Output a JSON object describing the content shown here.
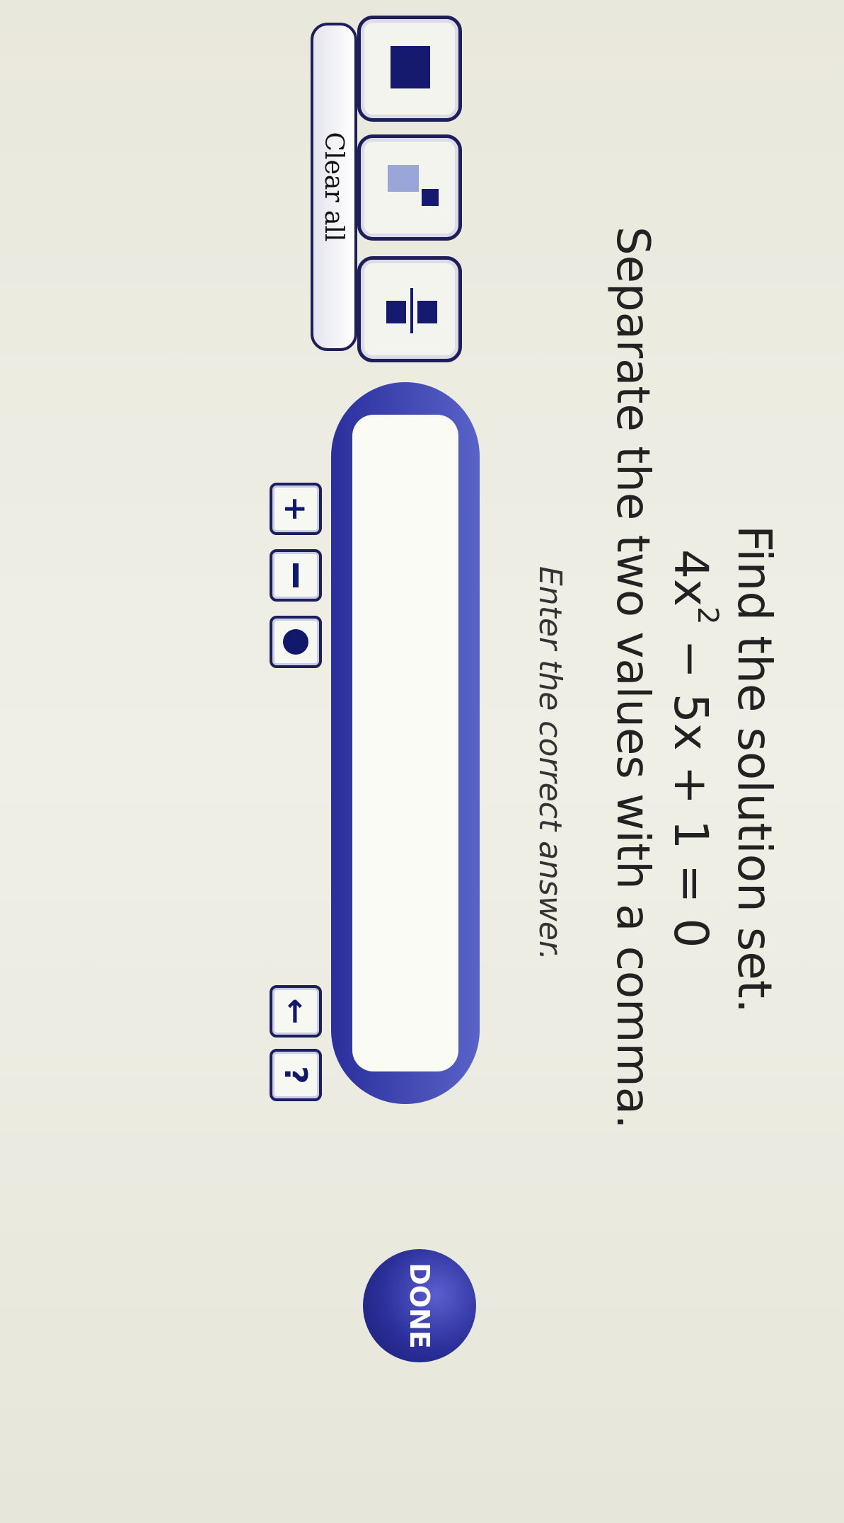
{
  "question": {
    "prompt": "Find the solution set.",
    "equation_prefix": "4x",
    "equation_exponent": "2",
    "equation_suffix": " − 5x + 1 = 0",
    "instruction": "Separate the two values with a comma.",
    "enter_hint": "Enter the correct answer."
  },
  "toolbar": {
    "template_icons": [
      "box-template-icon",
      "exponent-template-icon",
      "fraction-template-icon"
    ],
    "clear_label": "Clear all",
    "plus_symbol": "+",
    "help_symbol": "?",
    "backspace_symbol": "←"
  },
  "answer": {
    "value": ""
  },
  "done_label": "DONE",
  "colors": {
    "accent": "#2b2f9a",
    "dark": "#151a6e"
  }
}
